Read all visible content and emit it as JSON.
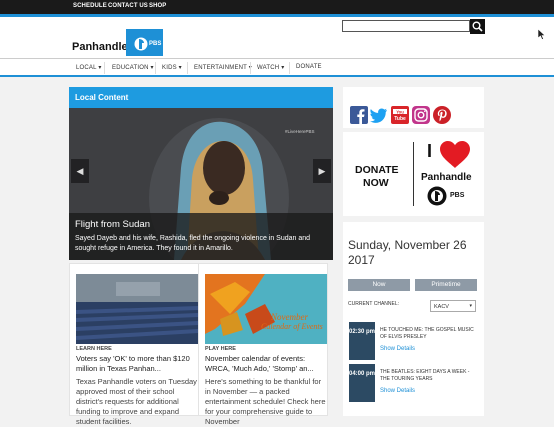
{
  "topnav": [
    "SCHEDULE",
    "CONTACT US",
    "SHOP"
  ],
  "brand": {
    "name": "Panhandle",
    "network": "PBS"
  },
  "mainnav": [
    "LOCAL ▾",
    "EDUCATION ▾",
    "KIDS ▾",
    "ENTERTAINMENT ▾",
    "WATCH ▾",
    "DONATE"
  ],
  "local": {
    "header": "Local Content",
    "photo_credit": "#LiveHerePBS",
    "slide_title": "Flight from Sudan",
    "slide_desc": "Sayed Dayeb and his wife, Rashida, fled the ongoing violence in Sudan and sought refuge in America. They found it in Amarillo."
  },
  "cards": [
    {
      "kicker": "LEARN HERE",
      "title": "Voters say 'OK' to more than $120 million in Texas Panhan...",
      "desc": "Texas Panhandle voters on Tuesday approved most of their school district's requests for additional funding to improve and expand student facilities."
    },
    {
      "kicker": "PLAY HERE",
      "title": "November calendar of events: WRCA, 'Much Ado,' 'Stomp' an...",
      "desc": "Here's something to be thankful for in November — a packed entertainment schedule! Check here for your comprehensive guide to November",
      "img_line1": "November",
      "img_line2": "Calendar of Events"
    }
  ],
  "social": [
    "facebook-icon",
    "twitter-icon",
    "youtube-icon",
    "instagram-icon",
    "pinterest-icon"
  ],
  "donate": {
    "line1": "DONATE",
    "line2": "NOW",
    "line3": "I",
    "brand": "Panhandle",
    "network": "PBS"
  },
  "schedule": {
    "date": "Sunday, November 26 2017",
    "now_label": "Now",
    "primetime_label": "Primetime",
    "channel_label": "CURRENT CHANNEL:",
    "channel_value": "KACV",
    "items": [
      {
        "time": "02:30 pm",
        "title": "HE TOUCHED ME: THE GOSPEL MUSIC OF ELVIS PRESLEY",
        "link": "Show Details"
      },
      {
        "time": "04:00 pm",
        "title": "THE BEATLES: EIGHT DAYS A WEEK - THE TOURING YEARS",
        "link": "Show Details"
      }
    ]
  }
}
